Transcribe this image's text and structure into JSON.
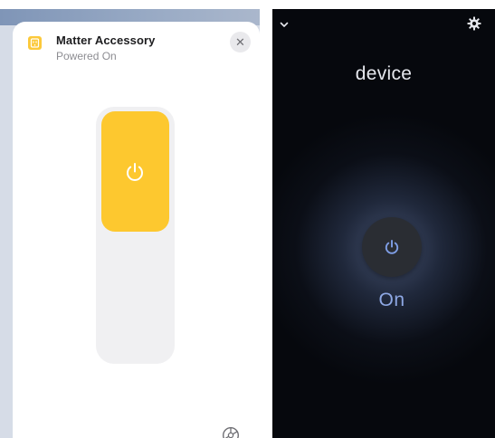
{
  "home_app": {
    "accessory_name": "Matter Accessory",
    "accessory_status": "Powered On",
    "close_symbol": "✕",
    "icons": {
      "accessory": "outlet-icon",
      "power": "power-icon",
      "settings": "gear-icon",
      "close": "close-icon"
    },
    "switch_state": "on",
    "colors": {
      "switch_on": "#fdc82f",
      "track": "#f0f0f2",
      "status_text": "#8d8d92"
    }
  },
  "device_app": {
    "device_name": "device",
    "state_label": "On",
    "icons": {
      "back": "chevron-down-icon",
      "settings": "gear-icon",
      "power": "power-icon"
    },
    "colors": {
      "background": "#06080d",
      "accent": "#8ea8e4",
      "power_icon": "#7f9ee6",
      "button": "#2a2d33"
    }
  }
}
